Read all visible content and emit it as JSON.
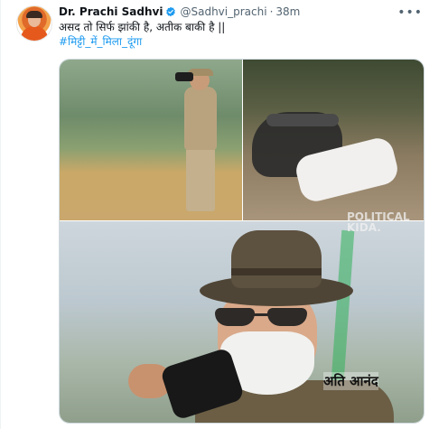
{
  "tweet": {
    "display_name": "Dr. Prachi Sadhvi",
    "handle": "@Sadhvi_prachi",
    "separator": "·",
    "time": "38m",
    "more_label": "•••",
    "text": "असद तो सिर्फ झांकी है, अतीक बाकी है ||",
    "hashtag": "#मिट्टी_में_मिला_दूंगा"
  },
  "media": {
    "watermark_line1": "POLITICAL",
    "watermark_line2": "KIDA.",
    "caption": "अति आनंद"
  },
  "icons": {
    "verified": "verified-badge-icon",
    "more": "more-icon"
  },
  "colors": {
    "link": "#1d9bf0",
    "secondary": "#536471",
    "verified": "#1d9bf0"
  }
}
